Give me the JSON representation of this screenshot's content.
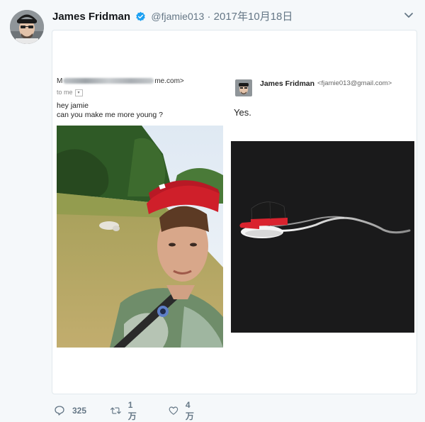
{
  "author": {
    "name": "James Fridman",
    "handle": "@fjamie013",
    "separator": "·",
    "date": "2017年10月18日",
    "verified": true
  },
  "left_email": {
    "from_prefix": "M",
    "from_suffix": "me.com>",
    "to_label": "to me",
    "line1": "hey jamie",
    "line2": "can you make me more young ?"
  },
  "right_email": {
    "sender_name": "James Fridman",
    "sender_email": "<fjamie013@gmail.com>",
    "reply_text": "Yes."
  },
  "actions": {
    "reply_count": "325",
    "retweet_count": "1万",
    "like_count": "4万"
  },
  "colors": {
    "background": "#f5f8fa",
    "verified_blue": "#1da1f2",
    "meta_gray": "#657786",
    "cap_red": "#d9232e",
    "dark_image_bg": "#1a1a1b"
  },
  "icons": [
    "verified-badge-icon",
    "chevron-down-icon",
    "reply-icon",
    "retweet-icon",
    "like-icon",
    "dropdown-arrow-icon"
  ]
}
